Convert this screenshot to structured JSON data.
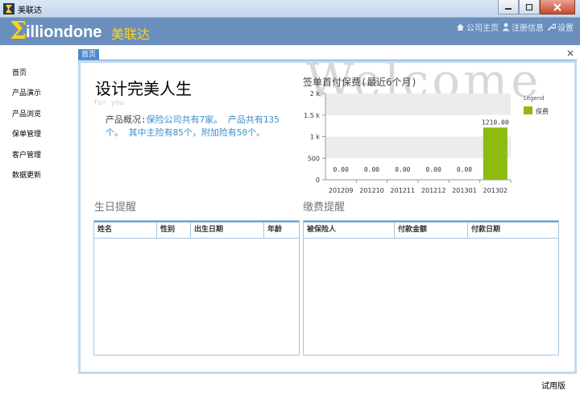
{
  "window": {
    "title": "美联达",
    "buttons": [
      "minimize",
      "maximize",
      "close"
    ]
  },
  "header": {
    "logo_sigma": "Σ",
    "logo_text": "illiondone",
    "logo_cn": "美联达",
    "links": [
      {
        "label": "公司主页",
        "icon": "home-icon"
      },
      {
        "label": "注册信息",
        "icon": "user-icon"
      },
      {
        "label": "设置",
        "icon": "wrench-icon"
      }
    ]
  },
  "sidebar": {
    "items": [
      {
        "label": "首页"
      },
      {
        "label": "产品演示"
      },
      {
        "label": "产品浏览"
      },
      {
        "label": "保单管理"
      },
      {
        "label": "客户管理"
      },
      {
        "label": "数据更新"
      }
    ]
  },
  "tabs": [
    {
      "label": "首页",
      "active": true
    }
  ],
  "home": {
    "watermark": "Welcome",
    "headline": "设计完美人生",
    "subline": "for you",
    "overview": {
      "prefix": "产品概况:",
      "text1": "保险公司共有7家。",
      "text2": "产品共有135个。",
      "text3": "其中主险有85个，附加险有50个。"
    }
  },
  "chart_data": {
    "type": "bar",
    "title": "签单首付保费(最近6个月)",
    "categories": [
      "201209",
      "201210",
      "201211",
      "201212",
      "201301",
      "201302"
    ],
    "series": [
      {
        "name": "保费",
        "values": [
          0,
          0,
          0,
          0,
          0,
          1210
        ],
        "color": "#8dbb10"
      }
    ],
    "value_labels": [
      "0.00",
      "0.00",
      "0.00",
      "0.00",
      "0.00",
      "1210.00"
    ],
    "yticks": [
      0,
      500,
      1000,
      1500,
      2000
    ],
    "ytick_labels": [
      "0",
      "500",
      "1 k",
      "1.5 k",
      "2 k"
    ],
    "ylim": [
      0,
      2000
    ],
    "legend_title": "Legend",
    "legend_position": "right"
  },
  "birthday": {
    "title": "生日提醒",
    "columns": [
      "姓名",
      "性别",
      "出生日期",
      "年龄"
    ]
  },
  "payment": {
    "title": "缴费提醒",
    "columns": [
      "被保险人",
      "付款金额",
      "付款日期"
    ]
  },
  "status": {
    "text": "试用版"
  }
}
